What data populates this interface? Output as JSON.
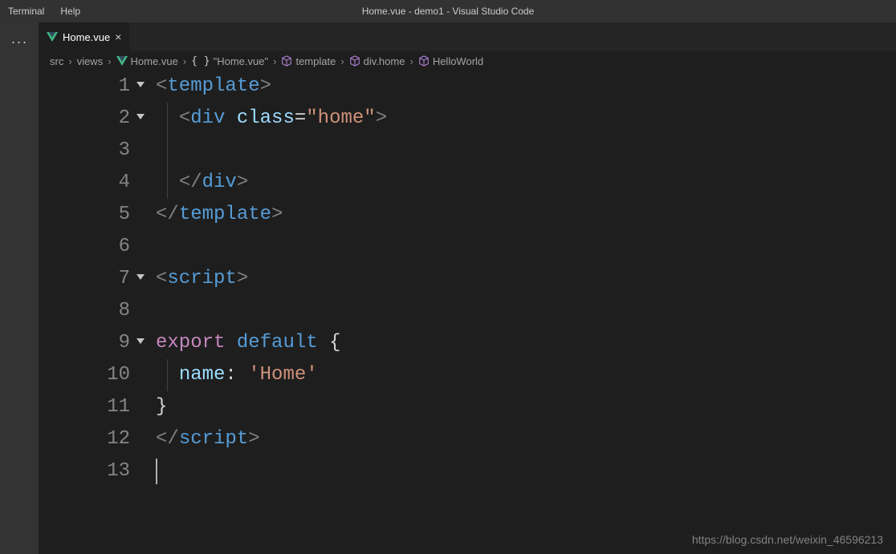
{
  "menubar": {
    "items": [
      "Terminal",
      "Help"
    ]
  },
  "window_title": "Home.vue - demo1 - Visual Studio Code",
  "tab": {
    "label": "Home.vue",
    "icon": "vue-icon"
  },
  "breadcrumbs": [
    {
      "label": "src",
      "icon": null
    },
    {
      "label": "views",
      "icon": null
    },
    {
      "label": "Home.vue",
      "icon": "vue"
    },
    {
      "label": "\"Home.vue\"",
      "icon": "braces"
    },
    {
      "label": "template",
      "icon": "cube"
    },
    {
      "label": "div.home",
      "icon": "cube"
    },
    {
      "label": "HelloWorld",
      "icon": "cube"
    }
  ],
  "code": {
    "lines": [
      {
        "n": 1,
        "fold": true,
        "guide": false,
        "tokens": [
          [
            "punct",
            "<"
          ],
          [
            "tag",
            "template"
          ],
          [
            "punct",
            ">"
          ]
        ]
      },
      {
        "n": 2,
        "fold": true,
        "guide": true,
        "tokens": [
          [
            "plain",
            "  "
          ],
          [
            "punct",
            "<"
          ],
          [
            "tag",
            "div"
          ],
          [
            "plain",
            " "
          ],
          [
            "attr",
            "class"
          ],
          [
            "op",
            "="
          ],
          [
            "string",
            "\"home\""
          ],
          [
            "punct",
            ">"
          ]
        ]
      },
      {
        "n": 3,
        "fold": false,
        "guide": true,
        "tokens": []
      },
      {
        "n": 4,
        "fold": false,
        "guide": true,
        "tokens": [
          [
            "plain",
            "  "
          ],
          [
            "punct",
            "</"
          ],
          [
            "tag",
            "div"
          ],
          [
            "punct",
            ">"
          ]
        ]
      },
      {
        "n": 5,
        "fold": false,
        "guide": false,
        "tokens": [
          [
            "punct",
            "</"
          ],
          [
            "tag",
            "template"
          ],
          [
            "punct",
            ">"
          ]
        ]
      },
      {
        "n": 6,
        "fold": false,
        "guide": false,
        "tokens": []
      },
      {
        "n": 7,
        "fold": true,
        "guide": false,
        "tokens": [
          [
            "punct",
            "<"
          ],
          [
            "tag",
            "script"
          ],
          [
            "punct",
            ">"
          ]
        ]
      },
      {
        "n": 8,
        "fold": false,
        "guide": false,
        "tokens": []
      },
      {
        "n": 9,
        "fold": true,
        "guide": false,
        "tokens": [
          [
            "kw-exp",
            "export"
          ],
          [
            "plain",
            " "
          ],
          [
            "kw-def",
            "default"
          ],
          [
            "plain",
            " "
          ],
          [
            "plain",
            "{"
          ]
        ]
      },
      {
        "n": 10,
        "fold": false,
        "guide": true,
        "tokens": [
          [
            "plain",
            "  "
          ],
          [
            "prop",
            "name"
          ],
          [
            "plain",
            ":"
          ],
          [
            "plain",
            " "
          ],
          [
            "string",
            "'Home'"
          ]
        ]
      },
      {
        "n": 11,
        "fold": false,
        "guide": false,
        "tokens": [
          [
            "plain",
            "}"
          ]
        ]
      },
      {
        "n": 12,
        "fold": false,
        "guide": false,
        "tokens": [
          [
            "punct",
            "</"
          ],
          [
            "tag",
            "script"
          ],
          [
            "punct",
            ">"
          ]
        ]
      },
      {
        "n": 13,
        "fold": false,
        "guide": false,
        "tokens": [],
        "cursor": true
      }
    ]
  },
  "watermark": "https://blog.csdn.net/weixin_46596213"
}
